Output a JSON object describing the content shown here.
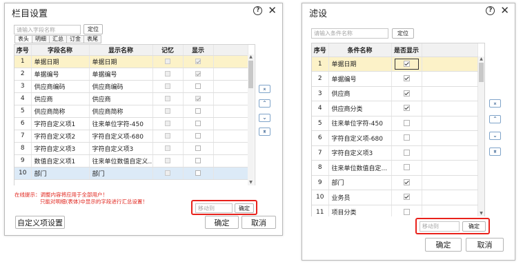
{
  "column_settings": {
    "title": "栏目设置",
    "search_placeholder": "请输入字段名称",
    "locate_label": "定位",
    "tabs": [
      "表头",
      "明细",
      "汇总",
      "订金",
      "表尾"
    ],
    "headers": [
      "序号",
      "字段名称",
      "显示名称",
      "记忆",
      "显示"
    ],
    "rows": [
      {
        "no": "1",
        "field": "单据日期",
        "display": "单据日期",
        "memory": false,
        "show": true
      },
      {
        "no": "2",
        "field": "单据编号",
        "display": "单据编号",
        "memory": false,
        "show": true
      },
      {
        "no": "3",
        "field": "供应商编码",
        "display": "供应商编码",
        "memory": false,
        "show": false
      },
      {
        "no": "4",
        "field": "供应商",
        "display": "供应商",
        "memory": false,
        "show": true
      },
      {
        "no": "5",
        "field": "供应商简称",
        "display": "供应商简称",
        "memory": false,
        "show": false
      },
      {
        "no": "6",
        "field": "字符自定义项1",
        "display": "往来单位字符-450",
        "memory": false,
        "show": false
      },
      {
        "no": "7",
        "field": "字符自定义项2",
        "display": "字符自定义项-680",
        "memory": false,
        "show": false
      },
      {
        "no": "8",
        "field": "字符自定义项3",
        "display": "字符自定义项3",
        "memory": false,
        "show": false
      },
      {
        "no": "9",
        "field": "数值自定义项1",
        "display": "往来单位数值自定义...",
        "memory": false,
        "show": false
      },
      {
        "no": "10",
        "field": "部门",
        "display": "部门",
        "memory": false,
        "show": false
      }
    ],
    "tip_line1": "在线提示：调整内容将应用于全部用户！",
    "tip_line2": "只能对明细(表体)中显示的字段进行汇总设置！",
    "move_placeholder": "移动到",
    "confirm_small": "确定",
    "custom_btn": "自定义项设置",
    "ok": "确定",
    "cancel": "取消"
  },
  "filter_settings": {
    "title": "滤设",
    "search_placeholder": "请输入条件名称",
    "locate_label": "定位",
    "headers": [
      "序号",
      "条件名称",
      "是否显示"
    ],
    "rows": [
      {
        "no": "1",
        "name": "单据日期",
        "show": true
      },
      {
        "no": "2",
        "name": "单据编号",
        "show": true
      },
      {
        "no": "3",
        "name": "供应商",
        "show": true
      },
      {
        "no": "4",
        "name": "供应商分类",
        "show": true
      },
      {
        "no": "5",
        "name": "往来单位字符-450",
        "show": false
      },
      {
        "no": "6",
        "name": "字符自定义项-680",
        "show": false
      },
      {
        "no": "7",
        "name": "字符自定义项3",
        "show": false
      },
      {
        "no": "8",
        "name": "往来单位数值自定...",
        "show": false
      },
      {
        "no": "9",
        "name": "部门",
        "show": true
      },
      {
        "no": "10",
        "name": "业务员",
        "show": true
      },
      {
        "no": "11",
        "name": "项目分类",
        "show": false
      }
    ],
    "move_placeholder": "移动到",
    "confirm_small": "确定",
    "ok": "确定",
    "cancel": "取消"
  },
  "icons": {
    "move_top": "⌅",
    "move_up": "⌃",
    "move_down": "⌄",
    "move_bottom": "⌆"
  }
}
